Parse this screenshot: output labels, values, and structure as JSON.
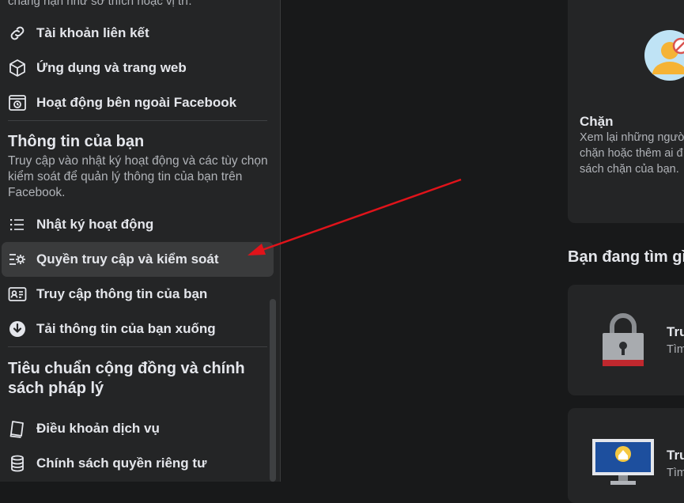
{
  "sidebar": {
    "top_partial_text": "chẳng hạn như sở thích hoặc vị trí.",
    "items_top": [
      {
        "label": "Tài khoản liên kết",
        "icon": "link-icon"
      },
      {
        "label": "Ứng dụng và trang web",
        "icon": "cube-icon"
      },
      {
        "label": "Hoạt động bên ngoài Facebook",
        "icon": "offsite-activity-icon"
      }
    ],
    "section_info": {
      "title": "Thông tin của bạn",
      "description": "Truy cập vào nhật ký hoạt động và các tùy chọn kiểm soát để quản lý thông tin của bạn trên Facebook.",
      "items": [
        {
          "label": "Nhật ký hoạt động",
          "icon": "list-icon"
        },
        {
          "label": "Quyền truy cập và kiểm soát",
          "icon": "settings-list-icon",
          "active": true
        },
        {
          "label": "Truy cập thông tin của bạn",
          "icon": "id-card-icon"
        },
        {
          "label": "Tải thông tin của bạn xuống",
          "icon": "download-icon"
        }
      ]
    },
    "section_policy": {
      "title": "Tiêu chuẩn cộng đồng và chính sách pháp lý",
      "items": [
        {
          "label": "Điều khoản dịch vụ",
          "icon": "book-icon"
        },
        {
          "label": "Chính sách quyền riêng tư",
          "icon": "database-icon"
        }
      ]
    }
  },
  "main": {
    "block_card": {
      "title": "Chặn",
      "description_lines": [
        "Xem lại những ngườ",
        "chặn hoặc thêm ai đ",
        "sách chặn của bạn."
      ]
    },
    "heading": "Bạn đang tìm gì",
    "card_lock": {
      "title": "Tru",
      "subtitle": "Tìm"
    },
    "card_monitor": {
      "title": "Tru",
      "subtitle": "Tìm"
    }
  },
  "colors": {
    "annotation_arrow": "#e0131a",
    "background": "#18191a",
    "sidebar": "#242526"
  }
}
